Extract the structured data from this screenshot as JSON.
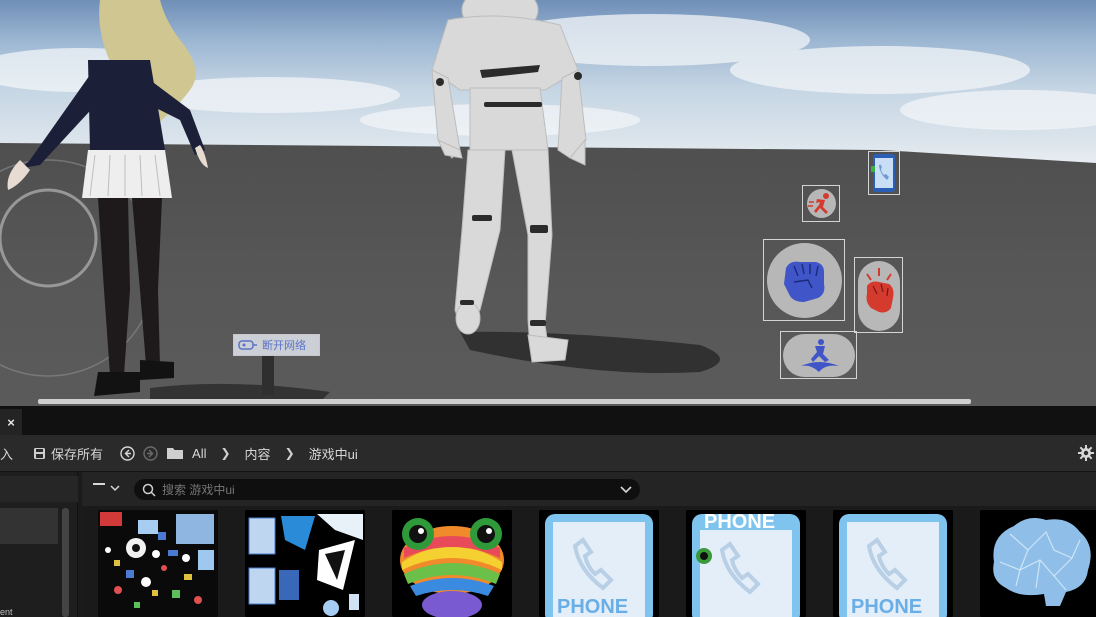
{
  "viewport": {
    "hud": {
      "network_button_label": "断开网络",
      "buttons": [
        {
          "name": "phone",
          "icon": "phone-icon"
        },
        {
          "name": "sprint",
          "icon": "running-man-icon"
        },
        {
          "name": "punch",
          "icon": "fist-icon"
        },
        {
          "name": "special-attack",
          "icon": "power-fist-icon"
        },
        {
          "name": "jump",
          "icon": "jump-icon"
        }
      ],
      "joystick_icon": "virtual-joystick-icon"
    }
  },
  "browser": {
    "tab": {
      "close_label": "×"
    },
    "toolbar": {
      "import_label": "入",
      "save_all_label": "保存所有",
      "breadcrumbs": [
        "All",
        "内容",
        "游戏中ui"
      ]
    },
    "search": {
      "placeholder": "搜索 游戏中ui"
    },
    "left_panel": {
      "partial_text": "ent"
    },
    "assets": [
      {
        "name": "ui-atlas-1",
        "icon": "texture-atlas-icon"
      },
      {
        "name": "ui-atlas-2",
        "icon": "texture-atlas-icon"
      },
      {
        "name": "rainbow-frog",
        "icon": "frog-icon"
      },
      {
        "name": "phone-1",
        "icon": "phone-icon"
      },
      {
        "name": "phone-2",
        "icon": "phone-icon"
      },
      {
        "name": "phone-3",
        "icon": "phone-icon"
      },
      {
        "name": "brain",
        "icon": "brain-icon"
      }
    ],
    "phone_text": "PHONE"
  },
  "colors": {
    "hud_blue": "#3f55c8",
    "hud_red": "#d43a2e",
    "editor_bg": "#1b1b1b"
  }
}
